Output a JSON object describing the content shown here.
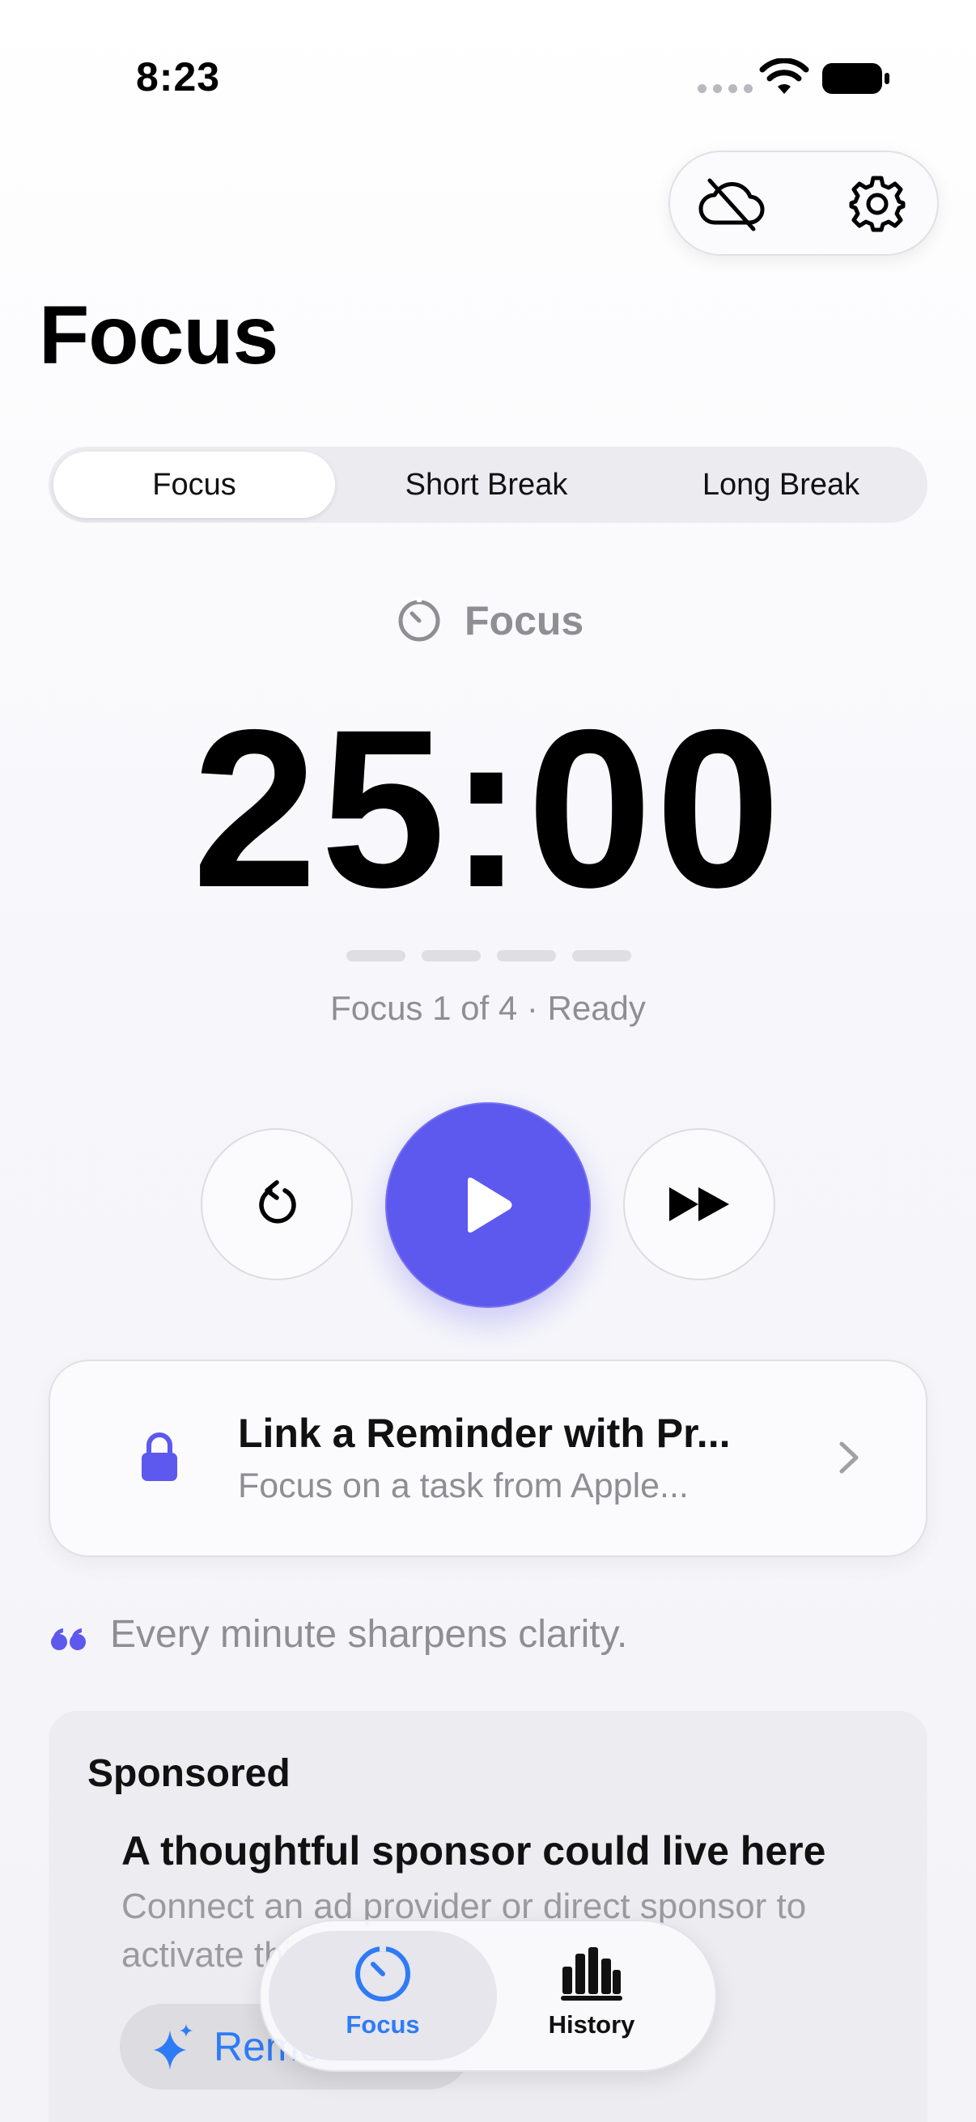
{
  "status_bar": {
    "time": "8:23"
  },
  "header": {
    "title": "Focus",
    "icons": [
      "cloud-off-icon",
      "gear-icon"
    ]
  },
  "segments": {
    "items": [
      "Focus",
      "Short Break",
      "Long Break"
    ],
    "selected": "Focus"
  },
  "timer": {
    "mode_label": "Focus",
    "time": "25:00",
    "sessions_total": 4,
    "sessions_completed": 0,
    "session_text": "Focus 1 of 4 · Ready"
  },
  "controls": {
    "reset_icon": "reset-icon",
    "play_icon": "play-icon",
    "skip_icon": "skip-forward-icon"
  },
  "reminder_card": {
    "title": "Link a Reminder with Pr...",
    "subtitle": "Focus on a task from Apple...",
    "icon": "lock-icon"
  },
  "quote": "Every minute sharpens clarity.",
  "sponsor": {
    "label": "Sponsored",
    "title": "A thoughtful sponsor could live here",
    "body": "Connect an ad provider or direct sponsor to activate this",
    "button_label": "Remove Ads"
  },
  "tabbar": {
    "items": [
      {
        "label": "Focus",
        "icon": "timer-icon",
        "active": true
      },
      {
        "label": "History",
        "icon": "chart-icon",
        "active": false
      }
    ]
  },
  "colors": {
    "accent": "#5D58EE",
    "tab_active": "#2F7BF5",
    "secondary_text": "#8E8E93"
  }
}
